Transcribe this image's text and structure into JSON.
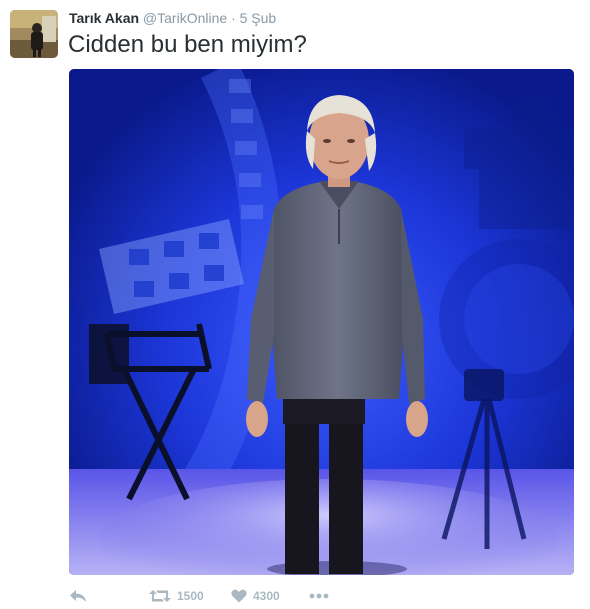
{
  "tweet": {
    "author": {
      "name": "Tarık Akan",
      "screen_name": "@TarikOnline",
      "separator": "·",
      "timestamp": "5 Şub"
    },
    "text": "Cidden bu ben miyim?",
    "media": {
      "icon": "photo"
    },
    "actions": {
      "reply_icon": "reply-icon",
      "retweet_icon": "retweet-icon",
      "retweet_count": "1500",
      "like_icon": "heart-icon",
      "like_count": "4300",
      "more_icon": "more-icon"
    },
    "colors": {
      "secondary_text": "#8899a6",
      "action_icon": "#aab8c2",
      "media_background": "#1432c8"
    }
  }
}
